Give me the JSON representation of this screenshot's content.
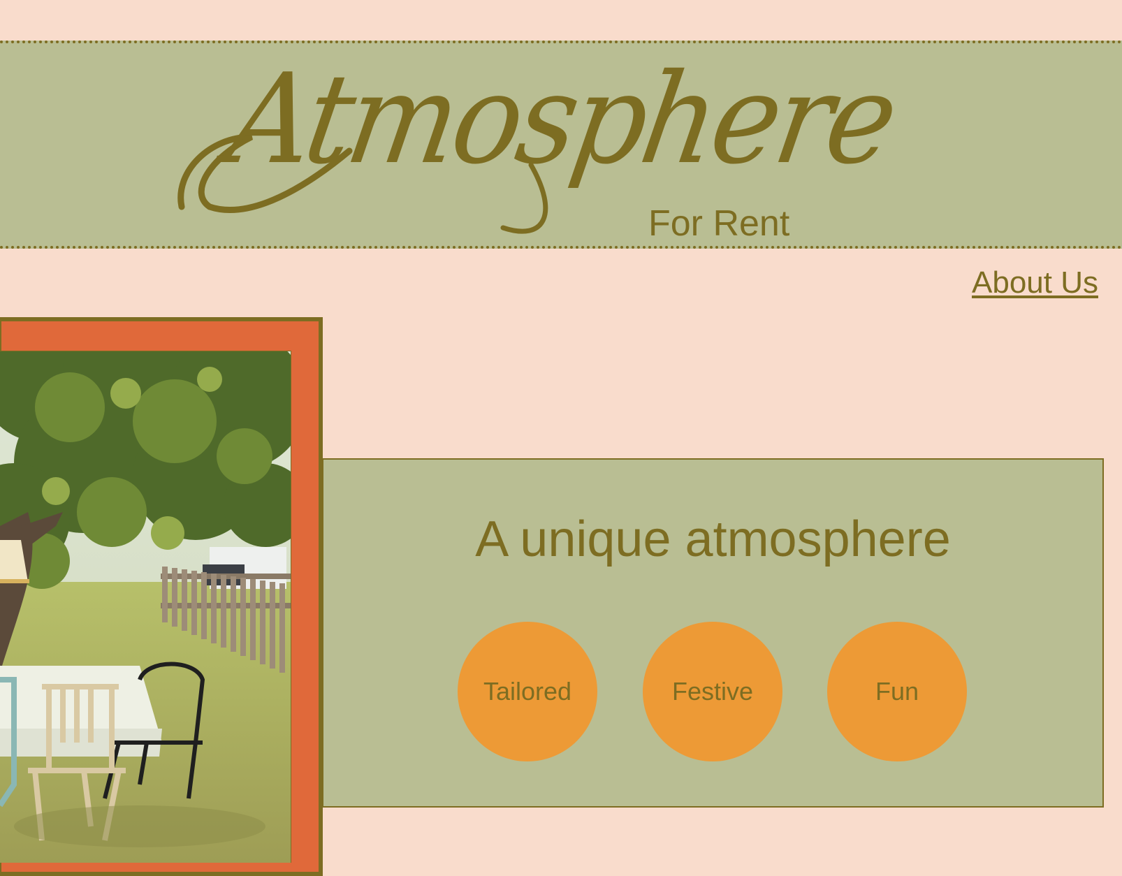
{
  "brand": {
    "title": "Atmosphere",
    "subtitle": "For Rent"
  },
  "nav": {
    "about_label": "About Us"
  },
  "hero": {
    "image_name": "garden-table-photo"
  },
  "panel": {
    "heading": "A unique atmosphere",
    "features": [
      {
        "label": "Tailored"
      },
      {
        "label": "Festive"
      },
      {
        "label": "Fun"
      }
    ]
  },
  "colors": {
    "page_background": "#f9dccc",
    "band_green": "#b9be93",
    "accent_olive": "#7d6d22",
    "frame_orange": "#e0693a",
    "circle_orange": "#ed9a36"
  }
}
